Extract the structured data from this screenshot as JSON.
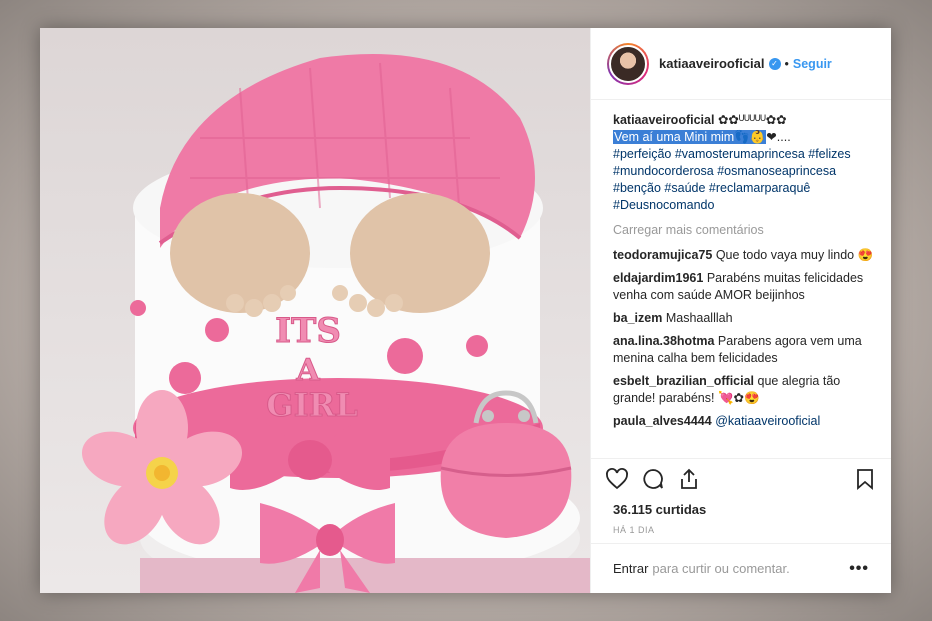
{
  "header": {
    "username": "katiaaveirooficial",
    "dot": "•",
    "follow_label": "Seguir"
  },
  "caption": {
    "username": "katiaaveirooficial",
    "emoji_line": "✿✿ᵁᵁᵁᵁᵁ✿✿",
    "highlight": "Vem aí uma Mini mim👣👶",
    "after": "❤....",
    "hashtags": "#perfeição #vamosterumaprincesa #felizes #mundocorderosa #osmanoseaprincesa #benção #saúde #reclamarparaquê #Deusnocomando"
  },
  "load_more": "Carregar mais comentários",
  "comments": [
    {
      "user": "teodoramujica75",
      "text": "Que todo vaya muy lindo 😍"
    },
    {
      "user": "eldajardim1961",
      "text": "Parabéns muitas felicidades venha com saúde AMOR beijinhos"
    },
    {
      "user": "ba_izem",
      "text": "Mashaalllah"
    },
    {
      "user": "ana.lina.38hotma",
      "text": "Parabens agora vem uma menina calha bem felicidades"
    },
    {
      "user": "esbelt_brazilian_official",
      "text": "que alegria tão grande! parabéns! 💘✿😍"
    },
    {
      "user": "paula_alves4444",
      "text": "@katiaaveirooficial"
    }
  ],
  "likes": "36.115 curtidas",
  "time": "HÁ 1 DIA",
  "add_comment": {
    "login": "Entrar",
    "rest": "para curtir ou comentar.",
    "more": "•••"
  },
  "image": {
    "cake_text_line1": "ITS",
    "cake_text_line2": "A",
    "cake_text_line3": "GIRL"
  },
  "colors": {
    "accent": "#3897f0",
    "pink": "#ec6a9a",
    "highlight": "#3b7fd6"
  }
}
